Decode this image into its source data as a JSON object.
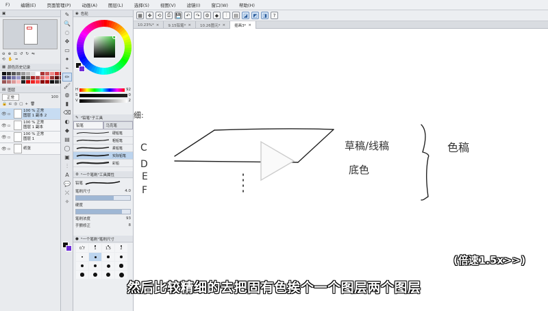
{
  "menu": [
    "F)",
    "编辑(E)",
    "页面管理(P)",
    "动画(A)",
    "图层(L)",
    "选择(S)",
    "视图(V)",
    "滤镜(I)",
    "窗口(W)",
    "帮助(H)"
  ],
  "toolbar_icons": [
    "grid-icon",
    "move-icon",
    "rotate-icon",
    "print-icon",
    "save-icon",
    "undo-icon",
    "redo-icon",
    "settings-icon",
    "fill-icon",
    "ruler-icon",
    "tone-icon",
    "snap-icon",
    "snap2-icon",
    "snap3-icon",
    "help-icon"
  ],
  "tabs": [
    "10.23%*",
    "9.15铅笔*",
    "10.26图元*",
    "插画3*"
  ],
  "color_panel": {
    "title": "色轮",
    "fg_color": "#111111",
    "bg_color": "#6f2cd8"
  },
  "color_history": {
    "title": "颜色历史记录"
  },
  "layer_panel": {
    "blend": "正常",
    "opacity": "100",
    "layers": [
      {
        "line1": "100 % 正常",
        "line2": "图层 1 副本 2",
        "selected": true
      },
      {
        "line1": "100 % 正常",
        "line2": "图层 1 副本",
        "selected": false
      },
      {
        "line1": "100 % 正常",
        "line2": "图层 1",
        "selected": false
      },
      {
        "line1": "",
        "line2": "纸张",
        "selected": false
      }
    ]
  },
  "sub_tool": {
    "title": "\"铅笔\"子工具",
    "tabs": [
      "铅笔",
      "马克笔"
    ],
    "brushes": [
      "硬铅笔",
      "粗铅笔",
      "柔铅笔",
      "实际铅笔",
      "彩铅"
    ]
  },
  "tool_props": {
    "title": "\"一个笔刷\"工具属性",
    "brush_name": "铅笔",
    "size_label": "笔刷尺寸",
    "size_value": "4.0",
    "hardness_label": "硬度",
    "density_label": "笔刷浓度",
    "density_value": "93",
    "stabilizer_label": "手颤修正",
    "stabilizer_value": "8"
  },
  "brush_size": {
    "title": "\"一个笔刷\"笔刷尺寸",
    "sizes": [
      "0.7",
      "1",
      "1.5",
      "2"
    ]
  },
  "canvas_notes": {
    "letters": [
      "C",
      "D",
      "E",
      "F"
    ],
    "stray": "细:",
    "right_top": "草稿/线稿",
    "right_mid": "底色",
    "right_label": "色稿"
  },
  "speed_label": "(倍速1.5x>>)",
  "subtitle": "然后比较精细的去把固有色挨个一个图层两个图层"
}
